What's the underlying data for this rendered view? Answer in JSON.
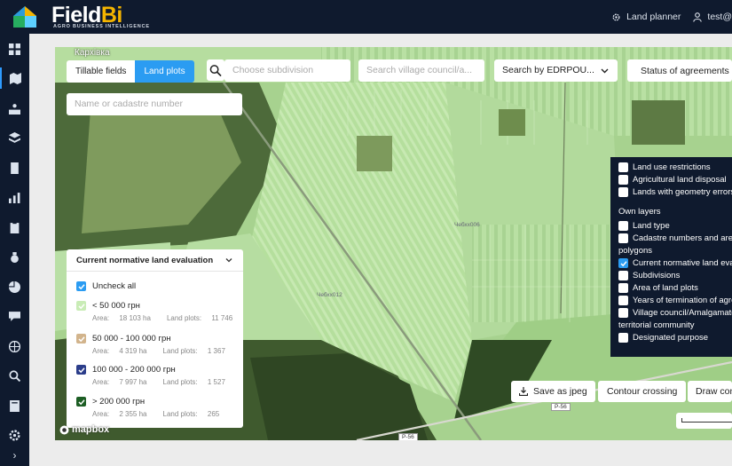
{
  "app": {
    "brand_main": "Field",
    "brand_accent": "Bi",
    "brand_sub": "AGRO BUSINESS INTELLIGENCE"
  },
  "topbar": {
    "land_planner": "Land planner",
    "user": "test@"
  },
  "sidebar": {
    "icons": [
      "grid-icon",
      "map-icon",
      "fields-icon",
      "layers-icon",
      "documents-icon",
      "chart-icon",
      "clipboard-icon",
      "money-bag-icon",
      "pie-chart-icon",
      "chat-icon",
      "globe-icon",
      "search-analytics-icon",
      "book-icon",
      "settings-icon",
      "expand-icon"
    ]
  },
  "map": {
    "place_name": "Кархівка",
    "tabs": [
      {
        "label": "Tillable fields",
        "active": false
      },
      {
        "label": "Land plots",
        "active": true
      }
    ],
    "subdivision_placeholder": "Choose subdivision",
    "village_placeholder": "Search village council/a...",
    "edrpou_label": "Search by EDRPOU...",
    "status_button": "Status of agreements",
    "cadastre_placeholder": "Name or cadastre number",
    "save_jpeg": "Save as jpeg",
    "contour_crossing": "Contour crossing",
    "draw_contour": "Draw cont",
    "mapbox": "mapbox",
    "road_labels": [
      "P-56",
      "P-56"
    ],
    "plot_labels": [
      "Чебхх006",
      "Чебхх012"
    ]
  },
  "legend": {
    "title": "Current normative land evaluation",
    "uncheck_all": "Uncheck all",
    "area_prefix": "Area:",
    "plots_prefix": "Land plots:",
    "items": [
      {
        "label": "< 50 000 грн",
        "area": "18 103 ha",
        "plots": "11 746",
        "color": "#c9ecb6"
      },
      {
        "label": "50 000 - 100 000 грн",
        "area": "4 319 ha",
        "plots": "1 367",
        "color": "#d2b48c"
      },
      {
        "label": "100 000 - 200 000 грн",
        "area": "7 997 ha",
        "plots": "1 527",
        "color": "#2b3d8a"
      },
      {
        "label": "> 200 000 грн",
        "area": "2 355 ha",
        "plots": "265",
        "color": "#1d5e24"
      }
    ]
  },
  "layers": {
    "items": [
      {
        "label": "Land use restrictions",
        "checked": false
      },
      {
        "label": "Agricultural land disposal",
        "checked": false
      },
      {
        "label": "Lands with geometry errors",
        "checked": false
      }
    ],
    "own_layers_title": "Own layers",
    "own": [
      {
        "label": "Land type",
        "checked": false
      },
      {
        "label": "Cadastre numbers and area",
        "checked": false
      },
      {
        "label": "polygons",
        "checked": null
      },
      {
        "label": "Current normative land evalu",
        "checked": true
      },
      {
        "label": "Subdivisions",
        "checked": false
      },
      {
        "label": "Area of land plots",
        "checked": false
      },
      {
        "label": "Years of termination of agree",
        "checked": false
      },
      {
        "label": "Village council/Amalgamated",
        "checked": false
      },
      {
        "label": "territorial community",
        "checked": null
      },
      {
        "label": "Designated purpose",
        "checked": false
      }
    ]
  }
}
